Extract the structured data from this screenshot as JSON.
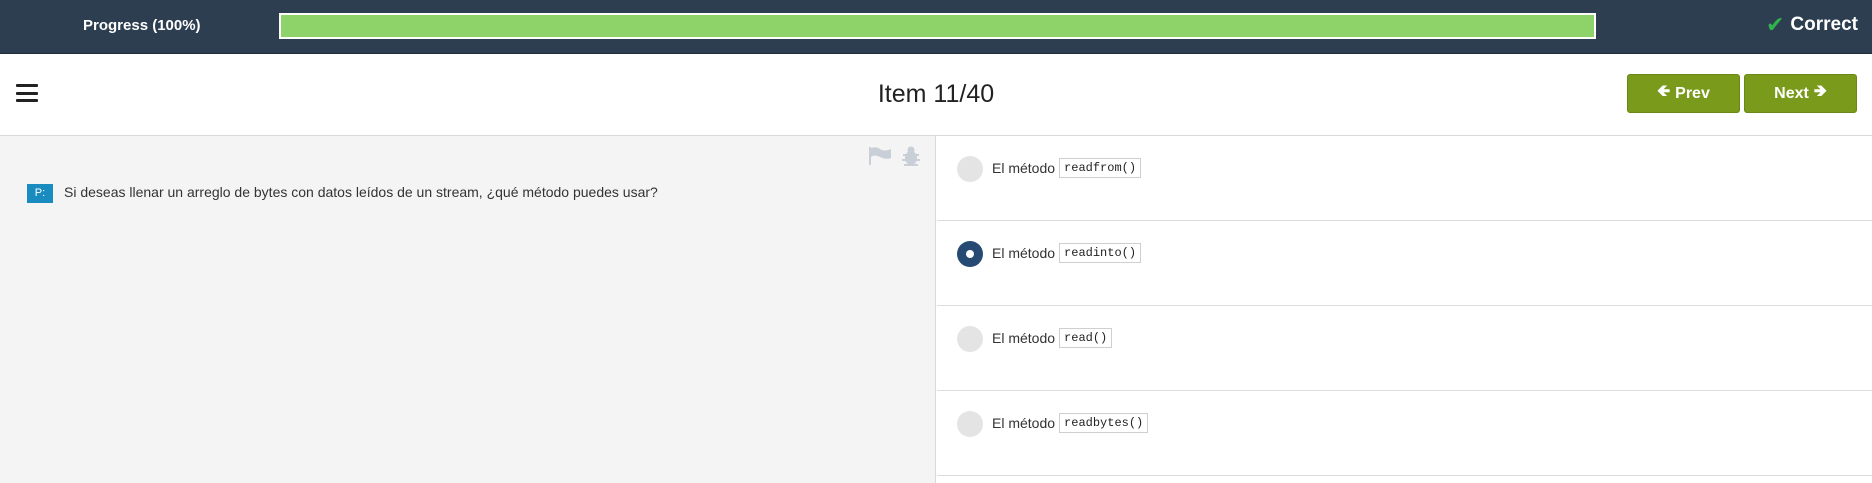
{
  "progress": {
    "label": "Progress (100%)",
    "percent": 100,
    "status": "Correct"
  },
  "header": {
    "title": "Item 11/40",
    "prev_label": "Prev",
    "next_label": "Next"
  },
  "question": {
    "badge": "P:",
    "text": "Si deseas llenar un arreglo de bytes con datos leídos de un stream, ¿qué método puedes usar?"
  },
  "options": [
    {
      "prefix": "El método",
      "code": "readfrom()",
      "selected": false
    },
    {
      "prefix": "El método",
      "code": "readinto()",
      "selected": true
    },
    {
      "prefix": "El método",
      "code": "read()",
      "selected": false
    },
    {
      "prefix": "El método",
      "code": "readbytes()",
      "selected": false
    }
  ],
  "colors": {
    "accent": "#7a9a1c",
    "progress": "#8ed26a",
    "topbar": "#2c3e50",
    "selected": "#274a73"
  }
}
